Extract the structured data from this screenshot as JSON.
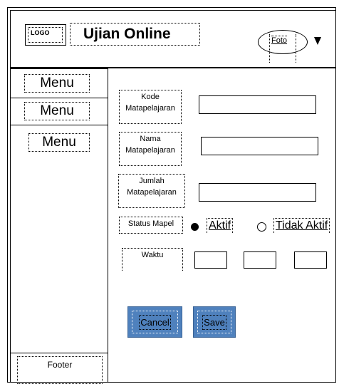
{
  "header": {
    "logo": "LOGO",
    "title": "Ujian Online",
    "foto": "Foto",
    "dropdown_icon": "chevron-down-icon"
  },
  "sidebar": {
    "items": [
      {
        "label": "Menu"
      },
      {
        "label": "Menu"
      },
      {
        "label": "Menu"
      }
    ],
    "footer": "Footer"
  },
  "form": {
    "kode": {
      "label_line1": "Kode",
      "label_line2": "Matapelajaran",
      "value": ""
    },
    "nama": {
      "label_line1": "Nama",
      "label_line2": "Matapelajaran",
      "value": ""
    },
    "jumlah": {
      "label_line1": "Jumlah",
      "label_line2": "Matapelajaran",
      "value": ""
    },
    "status": {
      "label": "Status Mapel",
      "options": [
        {
          "label": "Aktif",
          "selected": true
        },
        {
          "label": "Tidak Aktif",
          "selected": false
        }
      ]
    },
    "waktu": {
      "label": "Waktu",
      "fields": [
        "",
        "",
        ""
      ]
    }
  },
  "buttons": {
    "cancel": "Cancel",
    "save": "Save"
  },
  "colors": {
    "button": "#4f81bd"
  }
}
